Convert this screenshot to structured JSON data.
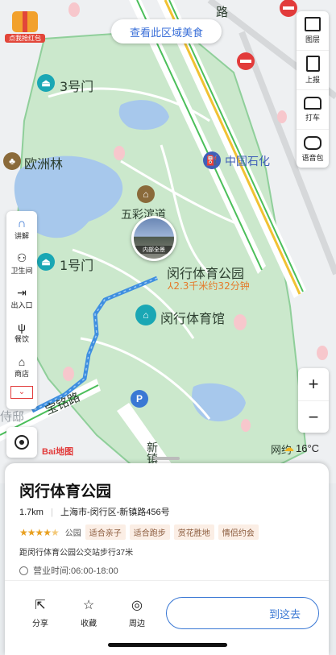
{
  "top": {
    "food_button": "查看此区域美食",
    "red_packet_label": "点我抢红包"
  },
  "right_tools": [
    {
      "label": "图层",
      "icon": "layers-icon"
    },
    {
      "label": "上报",
      "icon": "report-icon"
    },
    {
      "label": "打车",
      "icon": "taxi-icon"
    },
    {
      "label": "语音包",
      "icon": "voice-pack-icon"
    }
  ],
  "left_tools": [
    {
      "label": "讲解",
      "icon": "headphones-icon"
    },
    {
      "label": "卫生间",
      "icon": "toilet-icon"
    },
    {
      "label": "出入口",
      "icon": "exit-icon"
    },
    {
      "label": "餐饮",
      "icon": "food-icon"
    },
    {
      "label": "商店",
      "icon": "shop-icon"
    }
  ],
  "map": {
    "labels": {
      "gate3": "3号门",
      "europe_forest": "欧洲林",
      "sinopec": "中国石化",
      "wucai": "五彩滨道",
      "gate1": "1号门",
      "park": "闵行体育公园",
      "route": "2.3千米约32分钟",
      "gym": "闵行体育馆",
      "baoming_road": "宝铭路",
      "xinzhen_road": "新镇",
      "lu_road": "路",
      "yidi": "侍邸",
      "wangyue": "网约",
      "inner_view": "内部全景"
    },
    "weather": "16°C",
    "logo": "Bai地图"
  },
  "zoom": {
    "in": "+",
    "out": "−"
  },
  "place": {
    "name": "闵行体育公园",
    "distance": "1.7km",
    "address": "上海市-闵行区-新镇路456号",
    "rating": 4.5,
    "category": "公园",
    "tags": [
      "适合亲子",
      "适合跑步",
      "赏花胜地",
      "情侣约会"
    ],
    "transit": "距闵行体育公园公交站步行37米",
    "hours": "营业时间:06:00-18:00"
  },
  "actions": [
    {
      "label": "分享",
      "icon": "share-icon"
    },
    {
      "label": "收藏",
      "icon": "star-icon"
    },
    {
      "label": "周边",
      "icon": "compass-icon"
    }
  ],
  "nav_button": "到这去",
  "colors": {
    "park_green": "#cbe8cc",
    "water": "#a7c8ec",
    "route_blue": "#3f8fe0",
    "accent_blue": "#3a78d4",
    "gold_star": "#e8a020"
  }
}
